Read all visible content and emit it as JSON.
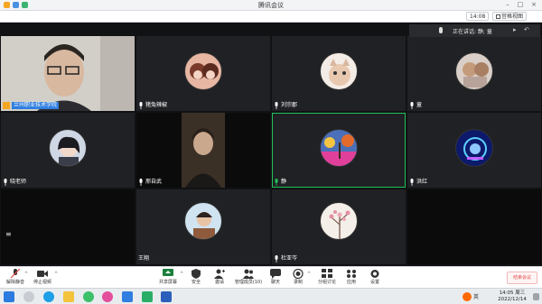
{
  "window": {
    "title": "腾讯会议"
  },
  "toolbar": {
    "time": "14:08",
    "view_label": "宫格视图"
  },
  "speaker": {
    "text": "正在讲话: 静; 童"
  },
  "participants": [
    {
      "name": "兰州职业技术学院"
    },
    {
      "name": "猪兔辣椒"
    },
    {
      "name": "刘宗郡"
    },
    {
      "name": "童"
    },
    {
      "name": "晓老师"
    },
    {
      "name": "邢自武"
    },
    {
      "name": "静"
    },
    {
      "name": "洪红"
    },
    {
      "name": "王翔"
    },
    {
      "name": "杜亚岑"
    }
  ],
  "controls": {
    "mute": "解除静音",
    "video": "停止视频",
    "share": "共享屏幕",
    "security": "安全",
    "invite": "邀请",
    "members": "管理成员(10)",
    "chat": "聊天",
    "record": "录制",
    "rooms": "分组讨论",
    "apps": "应用",
    "settings": "设置",
    "end": "结束会议"
  },
  "taskbar": {
    "ime": "英",
    "day": "周三",
    "time": "14:05",
    "date": "2022/12/14"
  },
  "colors": {
    "highlight": "#1fc35a",
    "end_button": "#e24a4a",
    "name_tag": "#2f7ee0"
  }
}
